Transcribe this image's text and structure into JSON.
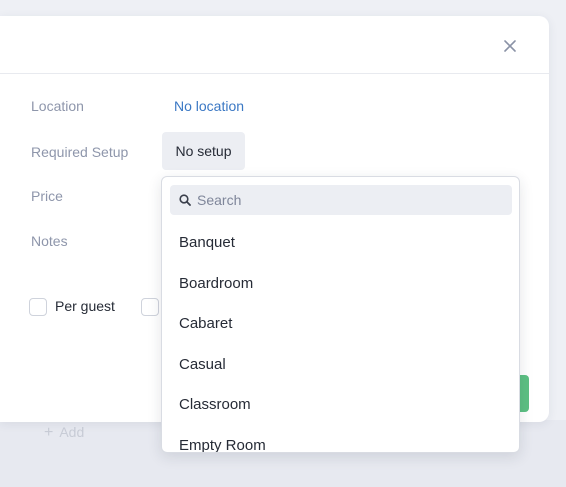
{
  "modal": {
    "close_icon": "close-icon"
  },
  "fields": {
    "location_label": "Location",
    "location_value": "No location",
    "setup_label": "Required Setup",
    "setup_value": "No setup",
    "price_label": "Price",
    "notes_label": "Notes"
  },
  "options": {
    "per_guest_label": "Per guest"
  },
  "background": {
    "add_label": "Add"
  },
  "dropdown": {
    "search_placeholder": "Search",
    "search_icon": "search-icon",
    "items": [
      "Banquet",
      "Boardroom",
      "Cabaret",
      "Casual",
      "Classroom",
      "Empty Room"
    ]
  },
  "colors": {
    "link": "#3b78c4",
    "primary_button": "#5cc083",
    "label": "#8e96ab"
  }
}
